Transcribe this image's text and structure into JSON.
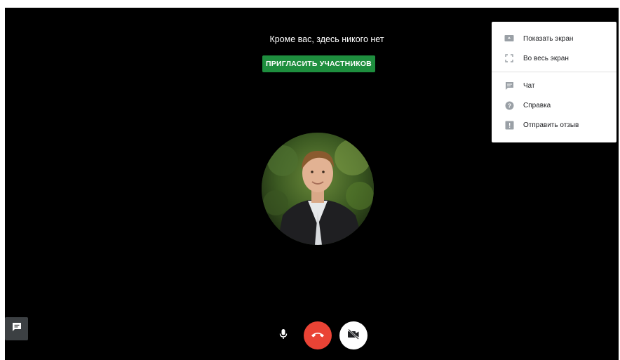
{
  "main": {
    "empty_message": "Кроме вас, здесь никого нет",
    "invite_button_label": "ПРИГЛАСИТЬ УЧАСТНИКОВ"
  },
  "menu": {
    "items": [
      {
        "label": "Показать экран",
        "icon": "present-screen-icon"
      },
      {
        "label": "Во весь экран",
        "icon": "fullscreen-icon"
      },
      {
        "label": "Чат",
        "icon": "chat-icon"
      },
      {
        "label": "Справка",
        "icon": "help-icon"
      },
      {
        "label": "Отправить отзыв",
        "icon": "feedback-icon"
      }
    ]
  },
  "controls": {
    "chat": "chat-icon",
    "mic": "mic-icon",
    "hangup": "hangup-icon",
    "camera": "camera-off-icon"
  },
  "colors": {
    "stage_bg": "#000000",
    "invite_green": "#1e8e3e",
    "hangup_red": "#ea4335",
    "menu_bg": "#ffffff"
  }
}
